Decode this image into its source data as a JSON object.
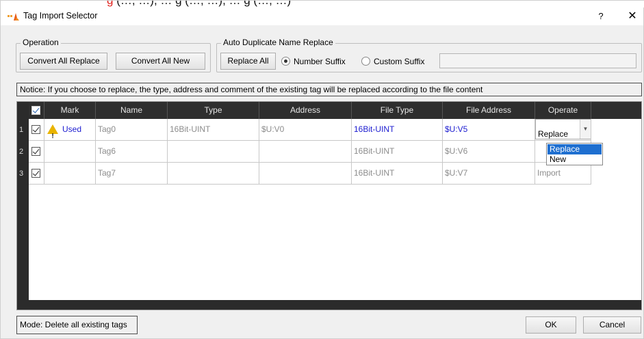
{
  "window": {
    "title": "Tag Import Selector",
    "help_label": "?",
    "close_label": "✕"
  },
  "top_clip": {
    "red_text": "g",
    "rest_text": " (…, …), … g (…, …), … g (…, …)"
  },
  "operation": {
    "legend": "Operation",
    "convert_all_replace": "Convert All Replace",
    "convert_all_new": "Convert All New"
  },
  "auto_duplicate": {
    "legend": "Auto Duplicate Name Replace",
    "replace_all": "Replace All",
    "number_suffix": "Number Suffix",
    "custom_suffix": "Custom Suffix",
    "selected": "Number Suffix",
    "custom_suffix_value": ""
  },
  "notice": "Notice: If you choose to replace, the type, address and comment of the existing tag will be replaced according to the file content",
  "table": {
    "headers": [
      "Mark",
      "Name",
      "Type",
      "Address",
      "File Type",
      "File Address",
      "Operate"
    ],
    "rows": [
      {
        "num": "1",
        "checked": true,
        "mark": "Used",
        "mark_icon": "warning-icon",
        "name": "Tag0",
        "type": "16Bit-UINT",
        "address": "$U:V0",
        "file_type": "16Bit-UINT",
        "file_address": "$U:V5",
        "operate": "Replace"
      },
      {
        "num": "2",
        "checked": true,
        "mark": "",
        "name": "Tag6",
        "type": "",
        "address": "",
        "file_type": "16Bit-UINT",
        "file_address": "$U:V6",
        "operate": ""
      },
      {
        "num": "3",
        "checked": true,
        "mark": "",
        "name": "Tag7",
        "type": "",
        "address": "",
        "file_type": "16Bit-UINT",
        "file_address": "$U:V7",
        "operate": "Import"
      }
    ]
  },
  "operate_dropdown": {
    "options": [
      "Replace",
      "New"
    ],
    "highlighted": "Replace"
  },
  "footer": {
    "mode": "Mode: Delete all existing tags",
    "ok": "OK",
    "cancel": "Cancel"
  },
  "colors": {
    "header_bg": "#2e2e2e",
    "link_blue": "#1b1bd0",
    "selection_blue": "#1e6fd0",
    "warning_yellow": "#e9b400"
  }
}
